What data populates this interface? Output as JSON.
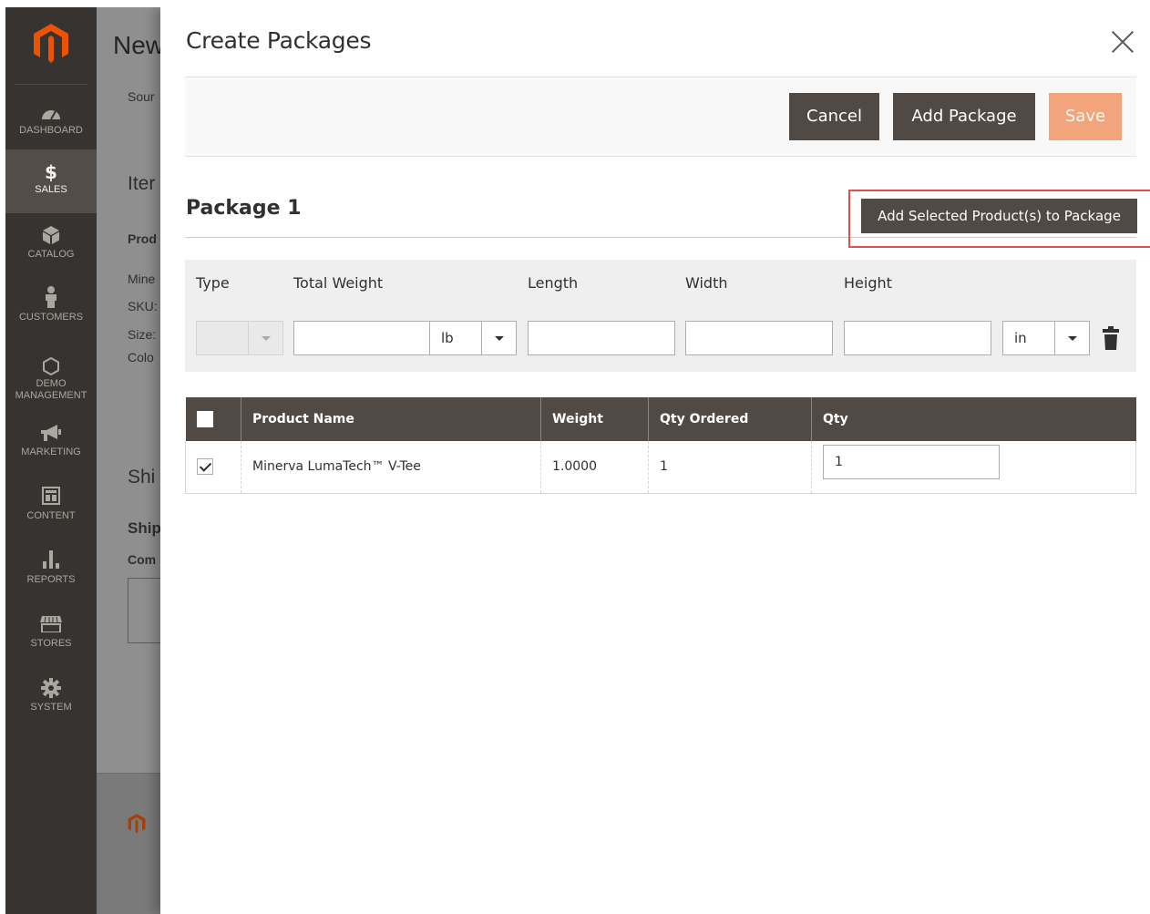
{
  "sidebar": {
    "items": [
      {
        "label": "DASHBOARD",
        "icon": "dashboard-icon"
      },
      {
        "label": "SALES",
        "icon": "dollar-icon",
        "glyph": "$"
      },
      {
        "label": "CATALOG",
        "icon": "catalog-cube-icon"
      },
      {
        "label": "CUSTOMERS",
        "icon": "customers-icon"
      },
      {
        "label": "DEMO",
        "label2": "MANAGEMENT",
        "icon": "hexagon-icon"
      },
      {
        "label": "MARKETING",
        "icon": "megaphone-icon"
      },
      {
        "label": "CONTENT",
        "icon": "content-layout-icon"
      },
      {
        "label": "REPORTS",
        "icon": "bar-chart-icon"
      },
      {
        "label": "STORES",
        "icon": "store-icon"
      },
      {
        "label": "SYSTEM",
        "icon": "gear-icon"
      }
    ]
  },
  "background_page": {
    "title": "New",
    "source": "Sour",
    "items_heading": "Iter",
    "product_col": "Prod",
    "product_name": "Mine",
    "sku": "SKU:",
    "size": "Size:",
    "color": "Colo",
    "shipping_heading": "Shi",
    "shipping_sub": "Ship",
    "comment": "Com"
  },
  "modal": {
    "title": "Create Packages",
    "buttons": {
      "cancel": "Cancel",
      "add_package": "Add Package",
      "save": "Save"
    },
    "package": {
      "title": "Package 1",
      "add_selected": "Add Selected Product(s) to Package",
      "params_headers": {
        "type": "Type",
        "total_weight": "Total Weight",
        "length": "Length",
        "width": "Width",
        "height": "Height"
      },
      "weight_unit": "lb",
      "dimension_unit": "in"
    },
    "items_table": {
      "columns": [
        "Product Name",
        "Weight",
        "Qty Ordered",
        "Qty"
      ],
      "rows": [
        {
          "product_name": "Minerva LumaTech™ V-Tee",
          "weight": "1.0000",
          "qty_ordered": "1",
          "qty": "1",
          "checked": true
        }
      ]
    }
  },
  "colors": {
    "accent_orange": "#f2a57d",
    "dark_button": "#514943",
    "highlight_red": "#e0504a",
    "sidebar_bg": "#373330"
  }
}
